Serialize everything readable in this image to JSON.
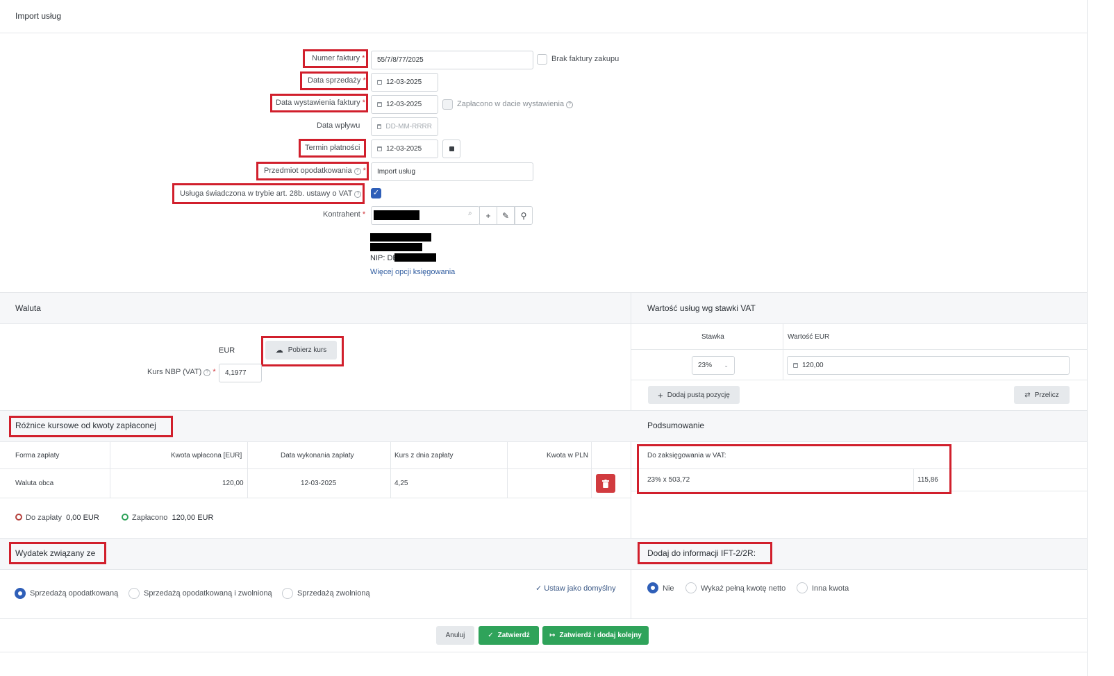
{
  "page": {
    "title": "Import usług"
  },
  "form": {
    "invoice_number": {
      "label": "Numer faktury",
      "req": "*",
      "value": "55/7/8/77/2025"
    },
    "no_invoice": {
      "label": "Brak faktury zakupu"
    },
    "sale_date": {
      "label": "Data sprzedaży",
      "req": "*",
      "value": "12-03-2025"
    },
    "issue_date": {
      "label": "Data wystawienia faktury",
      "req": "*",
      "value": "12-03-2025"
    },
    "paid_on_issue": {
      "label": "Zapłacono w dacie wystawienia"
    },
    "receipt_date": {
      "label": "Data wpływu",
      "placeholder": "DD-MM-RRRR"
    },
    "due_date": {
      "label": "Termin płatności",
      "value": "12-03-2025"
    },
    "subject": {
      "label": "Przedmiot opodatkowania",
      "req": "*",
      "value": "Import usług"
    },
    "art28b": {
      "label": "Usługa świadczona w trybie art. 28b. ustawy o VAT",
      "checked": true
    },
    "contractor": {
      "label": "Kontrahent",
      "req": "*"
    },
    "nip_label": "NIP: DE",
    "more_options": "Więcej opcji księgowania"
  },
  "currency": {
    "title": "Waluta",
    "code": "EUR",
    "fetch_rate_button": "Pobierz kurs",
    "rate_label": "Kurs NBP (VAT)",
    "rate_req": "*",
    "rate_value": "4,1977"
  },
  "vat_values": {
    "title": "Wartość usług wg stawki VAT",
    "col_rate": "Stawka",
    "col_value": "Wartość EUR",
    "row": {
      "rate": "23%",
      "value": "120,00"
    },
    "add_empty_button": "Dodaj pustą pozycję",
    "recalc_button": "Przelicz"
  },
  "fx_diff": {
    "title": "Różnice kursowe od kwoty zapłaconej",
    "columns": [
      "Forma zapłaty",
      "Kwota wpłacona [EUR]",
      "Data wykonania zapłaty",
      "Kurs z dnia zapłaty",
      "Kwota w PLN"
    ],
    "row": {
      "form": "Waluta obca",
      "amount": "120,00",
      "date": "12-03-2025",
      "rate": "4,25",
      "pln": ""
    },
    "to_pay_label": "Do zapłaty",
    "to_pay_value": "0,00 EUR",
    "paid_label": "Zapłacono",
    "paid_value": "120,00 EUR"
  },
  "summary": {
    "title": "Podsumowanie",
    "vat_header": "Do zaksięgowania w VAT:",
    "vat_row_label": "23% x 503,72",
    "vat_row_value": "115,86"
  },
  "expense": {
    "title": "Wydatek związany ze",
    "options": [
      "Sprzedażą opodatkowaną",
      "Sprzedażą opodatkowaną i zwolnioną",
      "Sprzedażą zwolnioną"
    ],
    "selected": 0,
    "set_default": "Ustaw jako domyślny"
  },
  "ift": {
    "title": "Dodaj do informacji IFT-2/2R:",
    "options": [
      "Nie",
      "Wykaż pełną kwotę netto",
      "Inna kwota"
    ],
    "selected": 0
  },
  "footer": {
    "cancel": "Anuluj",
    "confirm": "Zatwierdź",
    "confirm_add": "Zatwierdź i dodaj kolejny"
  },
  "colors": {
    "accent_blue": "#2f5fb8",
    "green": "#2fa35a",
    "red_highlight": "#d11f2c",
    "delete_red": "#d13b3f"
  }
}
